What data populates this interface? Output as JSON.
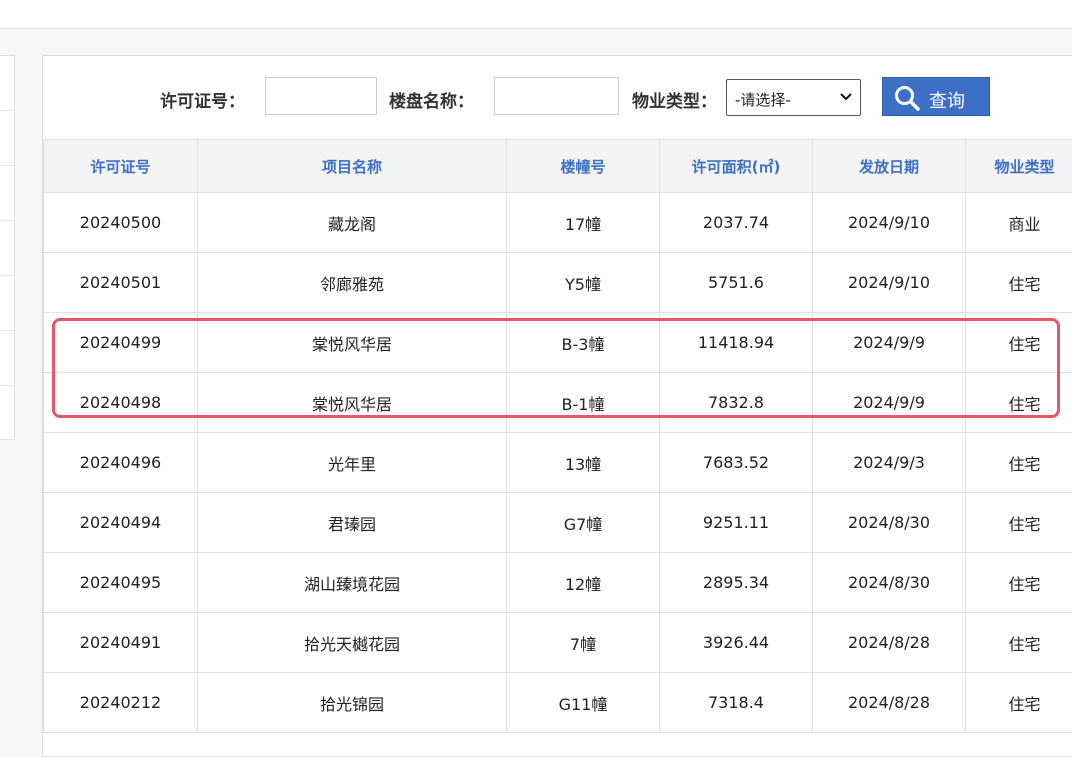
{
  "search": {
    "permit_label": "许可证号：",
    "permit_value": "",
    "name_label": "楼盘名称：",
    "name_value": "",
    "type_label": "物业类型：",
    "type_selected": "-请选择-",
    "query_label": "查询"
  },
  "table": {
    "columns": [
      "许可证号",
      "项目名称",
      "楼幢号",
      "许可面积(㎡)",
      "发放日期",
      "物业类型"
    ],
    "rows": [
      [
        "20240500",
        "藏龙阁",
        "17幢",
        "2037.74",
        "2024/9/10",
        "商业"
      ],
      [
        "20240501",
        "邻廊雅苑",
        "Y5幢",
        "5751.6",
        "2024/9/10",
        "住宅"
      ],
      [
        "20240499",
        "棠悦风华居",
        "B-3幢",
        "11418.94",
        "2024/9/9",
        "住宅"
      ],
      [
        "20240498",
        "棠悦风华居",
        "B-1幢",
        "7832.8",
        "2024/9/9",
        "住宅"
      ],
      [
        "20240496",
        "光年里",
        "13幢",
        "7683.52",
        "2024/9/3",
        "住宅"
      ],
      [
        "20240494",
        "君瑧园",
        "G7幢",
        "9251.11",
        "2024/8/30",
        "住宅"
      ],
      [
        "20240495",
        "湖山臻境花园",
        "12幢",
        "2895.34",
        "2024/8/30",
        "住宅"
      ],
      [
        "20240491",
        "拾光天樾花园",
        "7幢",
        "3926.44",
        "2024/8/28",
        "住宅"
      ],
      [
        "20240212",
        "拾光锦园",
        "G11幢",
        "7318.4",
        "2024/8/28",
        "住宅"
      ]
    ]
  },
  "colors": {
    "accent": "#3d6fc4",
    "highlight": "#e8566a"
  },
  "icons": {
    "query": "search-icon",
    "select": "chevron-down-icon"
  }
}
